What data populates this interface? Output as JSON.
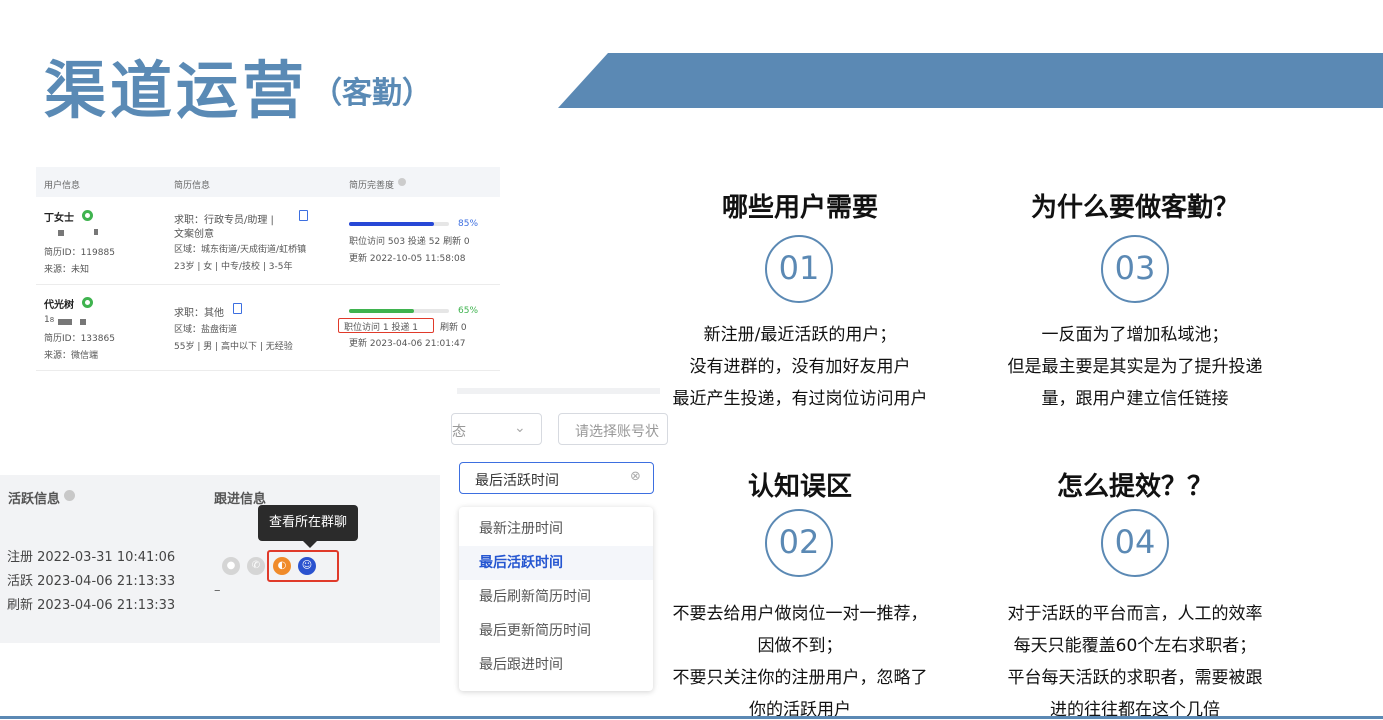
{
  "header": {
    "title": "渠道运营",
    "subtitle": "（客勤）"
  },
  "panel1": {
    "col_user": "用户信息",
    "col_resume": "简历信息",
    "col_complete": "简历完善度",
    "rows": [
      {
        "name": "丁女士",
        "resume_id": "简历ID：119885",
        "source": "来源：未知",
        "job": "求职：行政专员/助理 |",
        "job2": "文案创意",
        "area": "区域：城东街道/天成街道/虹桥镇",
        "profile": "23岁 | 女 | 中专/技校 | 3-5年",
        "percent": "85%",
        "percent_value": 0.85,
        "stats": "职位访问 503   投递 52   刷新 0",
        "updated": "更新 2022-10-05 11:58:08"
      },
      {
        "name": "代光树",
        "resume_id": "简历ID：133865",
        "source": "来源：微信端",
        "job": "求职：其他",
        "area": "区域：盐盘街道",
        "profile": "55岁 | 男 | 高中以下 | 无经验",
        "percent": "65%",
        "percent_value": 0.65,
        "stats_boxed": "职位访问 1    投递 1",
        "stats_rest": "刷新 0",
        "updated": "更新 2023-04-06 21:01:47"
      }
    ]
  },
  "panel2": {
    "col_active": "活跃信息",
    "col_follow": "跟进信息",
    "register": "注册 2022-03-31 10:41:06",
    "active": "活跃 2023-04-06 21:13:33",
    "refresh": "刷新 2023-04-06 21:13:33",
    "follow_value": "–",
    "tooltip": "查看所在群聊"
  },
  "panel3": {
    "select_partial": "态",
    "account_placeholder": "请选择账号状",
    "sort_value": "最后活跃时间",
    "options": [
      "最新注册时间",
      "最后活跃时间",
      "最后刷新简历时间",
      "最后更新简历时间",
      "最后跟进时间"
    ],
    "selected_index": 1
  },
  "sections": [
    {
      "title": "哪些用户需要",
      "num": "01",
      "lines": [
        "新注册/最近活跃的用户；",
        "没有进群的，没有加好友用户",
        "最近产生投递，有过岗位访问用户"
      ]
    },
    {
      "title": "为什么要做客勤？",
      "num": "03",
      "lines": [
        "一反面为了增加私域池；",
        "但是最主要是其实是为了提升投递",
        "量，跟用户建立信任链接"
      ]
    },
    {
      "title": "认知误区",
      "num": "02",
      "lines": [
        "不要去给用户做岗位一对一推荐，",
        "因做不到；",
        "不要只关注你的注册用户，忽略了",
        "你的活跃用户"
      ]
    },
    {
      "title": "怎么提效？？",
      "num": "04",
      "lines": [
        "对于活跃的平台而言，人工的效率",
        "每天只能覆盖60个左右求职者；",
        "平台每天活跃的求职者，需要被跟",
        "进的往往都在这个几倍"
      ]
    }
  ],
  "colors": {
    "accent": "#5b89b4",
    "highlight": "#e03a2a",
    "link": "#3d6fe0"
  }
}
